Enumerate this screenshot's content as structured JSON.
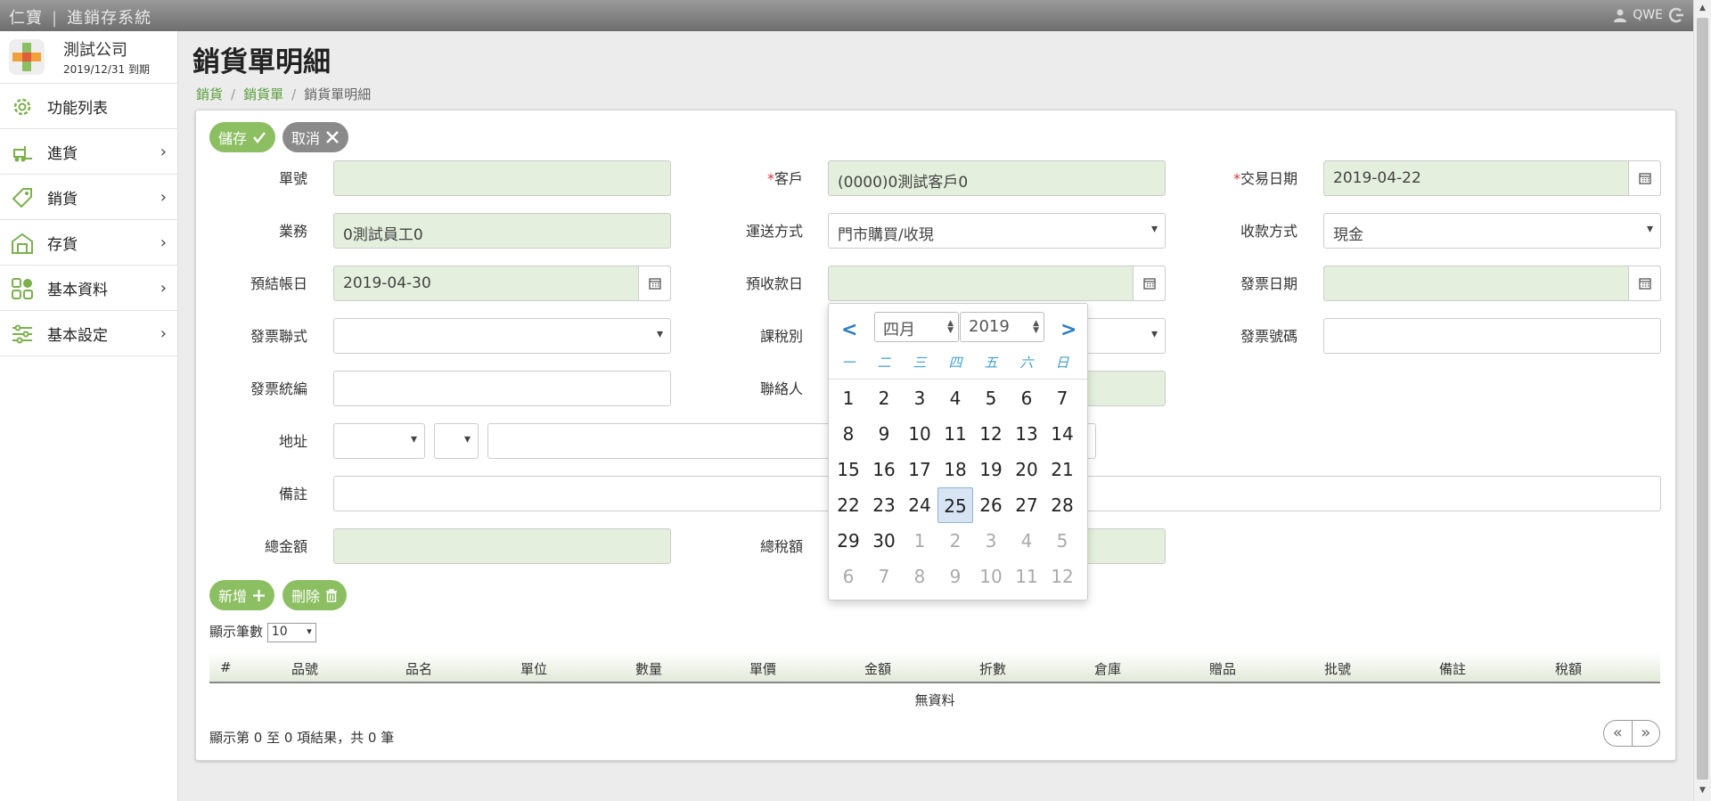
{
  "topbar": {
    "brand": "仁寶",
    "system": "進銷存系統",
    "user": "QWE"
  },
  "company": {
    "name": "測試公司",
    "expire": "2019/12/31 到期"
  },
  "menu": [
    {
      "label": "功能列表",
      "icon": "gear-icon"
    },
    {
      "label": "進貨",
      "icon": "forklift-icon"
    },
    {
      "label": "銷貨",
      "icon": "tag-icon"
    },
    {
      "label": "存貨",
      "icon": "warehouse-icon"
    },
    {
      "label": "基本資料",
      "icon": "grid-icon"
    },
    {
      "label": "基本設定",
      "icon": "sliders-icon"
    }
  ],
  "page": {
    "title": "銷貨單明細"
  },
  "breadcrumb": [
    "銷貨",
    "銷貨單",
    "銷貨單明細"
  ],
  "buttons": {
    "save": "儲存",
    "cancel": "取消",
    "add": "新增",
    "delete": "刪除"
  },
  "form": {
    "order_no": {
      "label": "單號",
      "value": ""
    },
    "customer": {
      "label": "客戶",
      "value": "(0000)0測試客戶0"
    },
    "trade_date": {
      "label": "交易日期",
      "value": "2019-04-22"
    },
    "salesperson": {
      "label": "業務",
      "value": "0測試員工0"
    },
    "delivery": {
      "label": "運送方式",
      "value": "門市購買/收現"
    },
    "payment": {
      "label": "收款方式",
      "value": "現金"
    },
    "closing_date": {
      "label": "預結帳日",
      "value": "2019-04-30"
    },
    "receipt_date": {
      "label": "預收款日",
      "value": ""
    },
    "invoice_date": {
      "label": "發票日期",
      "value": ""
    },
    "invoice_copy": {
      "label": "發票聯式",
      "value": ""
    },
    "tax_type": {
      "label": "課稅別",
      "value": ""
    },
    "invoice_no": {
      "label": "發票號碼",
      "value": ""
    },
    "tax_id": {
      "label": "發票統編",
      "value": ""
    },
    "contact": {
      "label": "聯絡人",
      "value": ""
    },
    "address": {
      "label": "地址",
      "value": ""
    },
    "note": {
      "label": "備註",
      "value": ""
    },
    "total": {
      "label": "總金額",
      "value": ""
    },
    "total_tax": {
      "label": "總稅額",
      "value": ""
    }
  },
  "datepicker": {
    "month": "四月",
    "year": "2019",
    "weekdays": [
      "一",
      "二",
      "三",
      "四",
      "五",
      "六",
      "日"
    ],
    "selected_day": "25",
    "weeks": [
      [
        "1",
        "2",
        "3",
        "4",
        "5",
        "6",
        "7"
      ],
      [
        "8",
        "9",
        "10",
        "11",
        "12",
        "13",
        "14"
      ],
      [
        "15",
        "16",
        "17",
        "18",
        "19",
        "20",
        "21"
      ],
      [
        "22",
        "23",
        "24",
        "25",
        "26",
        "27",
        "28"
      ],
      [
        "29",
        "30",
        "1",
        "2",
        "3",
        "4",
        "5"
      ],
      [
        "6",
        "7",
        "8",
        "9",
        "10",
        "11",
        "12"
      ]
    ]
  },
  "table": {
    "show_label": "顯示筆數",
    "page_size": "10",
    "columns": [
      "#",
      "品號",
      "品名",
      "單位",
      "數量",
      "單價",
      "金額",
      "折數",
      "倉庫",
      "贈品",
      "批號",
      "備註",
      "稅額"
    ],
    "empty": "無資料",
    "info": "顯示第 0 至 0 項結果，共 0 筆"
  }
}
